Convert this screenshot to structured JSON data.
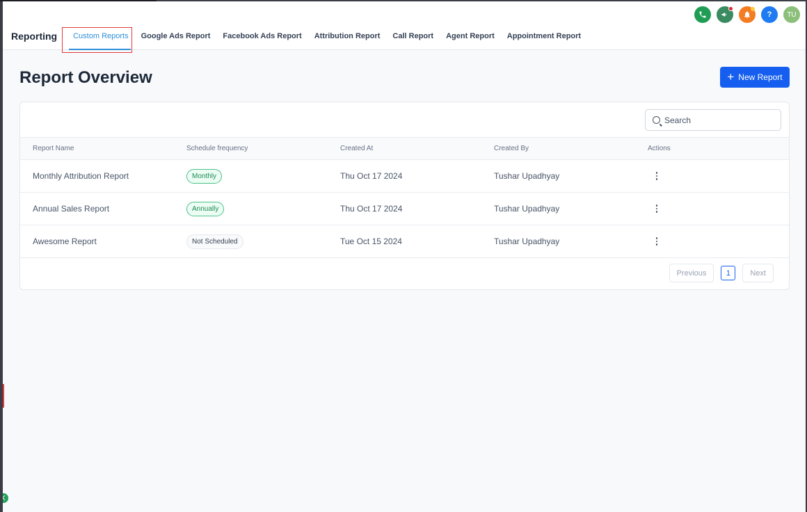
{
  "header": {
    "brand": "Reporting",
    "tabs": [
      {
        "label": "Custom Reports",
        "active": true
      },
      {
        "label": "Google Ads Report"
      },
      {
        "label": "Facebook Ads Report"
      },
      {
        "label": "Attribution Report"
      },
      {
        "label": "Call Report"
      },
      {
        "label": "Agent Report"
      },
      {
        "label": "Appointment Report"
      }
    ],
    "icons": [
      "phone-icon",
      "megaphone-icon",
      "bell-icon",
      "help-icon",
      "avatar"
    ],
    "avatar_initials": "TU",
    "help_glyph": "?"
  },
  "main": {
    "title": "Report Overview",
    "new_report_label": "New Report",
    "search_placeholder": "Search",
    "columns": [
      "Report Name",
      "Schedule frequency",
      "Created At",
      "Created By",
      "Actions"
    ],
    "rows": [
      {
        "name": "Monthly Attribution Report",
        "frequency": "Monthly",
        "created_at": "Thu Oct 17 2024",
        "created_by": "Tushar Upadhyay"
      },
      {
        "name": "Annual Sales Report",
        "frequency": "Annually",
        "created_at": "Thu Oct 17 2024",
        "created_by": "Tushar Upadhyay"
      },
      {
        "name": "Awesome Report",
        "frequency": "Not Scheduled",
        "created_at": "Tue Oct 15 2024",
        "created_by": "Tushar Upadhyay"
      }
    ],
    "pagination": {
      "previous": "Previous",
      "page": "1",
      "next": "Next"
    }
  },
  "colors": {
    "accent": "#155eef",
    "active_tab": "#2f8fd8",
    "badge_green": "#1e8a55"
  }
}
